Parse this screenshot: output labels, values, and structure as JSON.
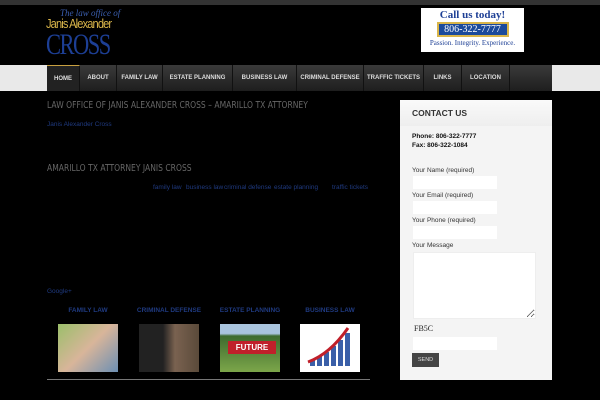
{
  "header": {
    "logo": {
      "line1": "The law office of",
      "line2": "Janis Alexander",
      "line3": "CROSS"
    },
    "call": {
      "title": "Call us today!",
      "phone": "806-322-7777",
      "tagline": "Passion. Integrity. Experience."
    }
  },
  "nav": [
    {
      "label": "HOME",
      "active": true
    },
    {
      "label": "ABOUT"
    },
    {
      "label": "FAMILY LAW"
    },
    {
      "label": "ESTATE PLANNING"
    },
    {
      "label": "BUSINESS LAW"
    },
    {
      "label": "CRIMINAL DEFENSE"
    },
    {
      "label": "TRAFFIC TICKETS"
    },
    {
      "label": "LINKS"
    },
    {
      "label": "LOCATION"
    }
  ],
  "main": {
    "title": "LAW OFFICE OF JANIS ALEXANDER CROSS – AMARILLO TX ATTORNEY",
    "author": "Janis Alexander Cross",
    "subtitle": "AMARILLO TX ATTORNEY JANIS CROSS",
    "tags": [
      "family law",
      "business law",
      "criminal defense",
      "estate planning",
      "traffic tickets"
    ],
    "google": "Google+",
    "tiles": [
      {
        "title": "FAMILY LAW"
      },
      {
        "title": "CRIMINAL DEFENSE"
      },
      {
        "title": "ESTATE PLANNING",
        "img_text": "FUTURE"
      },
      {
        "title": "BUSINESS LAW"
      }
    ]
  },
  "sidebar": {
    "title": "CONTACT US",
    "phone": "Phone: 806-322-7777",
    "fax": "Fax: 806-322-1084",
    "fields": {
      "name": "Your Name (required)",
      "email": "Your Email (required)",
      "phone": "Your Phone (required)",
      "message": "Your Message"
    },
    "captcha": "FB5C",
    "send": "SEND"
  }
}
